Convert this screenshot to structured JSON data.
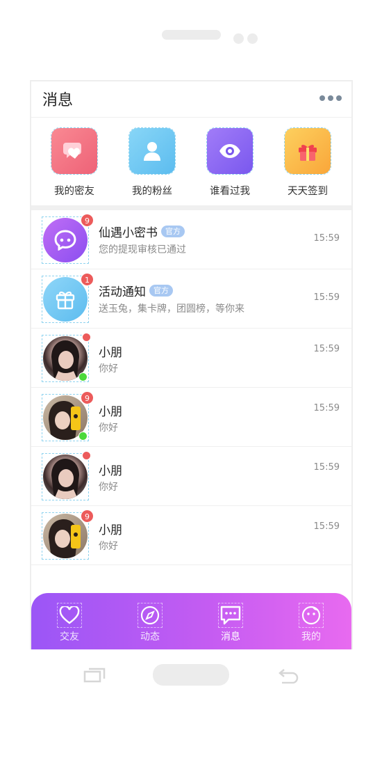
{
  "header": {
    "title": "消息"
  },
  "quick": [
    {
      "label": "我的密友",
      "icon": "heart-chat-icon",
      "color": "#f36f7f"
    },
    {
      "label": "我的粉丝",
      "icon": "user-icon",
      "color": "#6cc7f2"
    },
    {
      "label": "谁看过我",
      "icon": "eye-icon",
      "color": "#8a68f4"
    },
    {
      "label": "天天签到",
      "icon": "gift-icon",
      "color": "#fbb94a"
    }
  ],
  "messages": [
    {
      "name": "仙遇小密书",
      "tag": "官方",
      "text": "您的提现审核已通过",
      "time": "15:59",
      "badge": "9"
    },
    {
      "name": "活动通知",
      "tag": "官方",
      "text": "送玉兔，集卡牌，团圆榜，等你来",
      "time": "15:59",
      "badge": "1"
    },
    {
      "name": "小朋",
      "text": "你好",
      "time": "15:59"
    },
    {
      "name": "小朋",
      "text": "你好",
      "time": "15:59",
      "badge": "9"
    },
    {
      "name": "小朋",
      "text": "你好",
      "time": "15:59"
    },
    {
      "name": "小朋",
      "text": "你好",
      "time": "15:59",
      "badge": "9"
    }
  ],
  "tabs": [
    {
      "label": "交友",
      "icon": "heart-icon"
    },
    {
      "label": "动态",
      "icon": "compass-icon"
    },
    {
      "label": "消息",
      "icon": "message-icon",
      "active": true
    },
    {
      "label": "我的",
      "icon": "face-icon"
    }
  ],
  "colors": {
    "accent_start": "#9b56f6",
    "accent_end": "#e86af0",
    "badge": "#ec5b5b",
    "online": "#4bd93c"
  }
}
